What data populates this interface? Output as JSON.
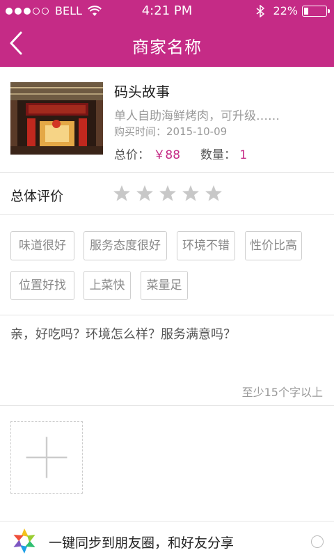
{
  "status_bar": {
    "carrier": "BELL",
    "time": "4:21 PM",
    "battery": "22%",
    "battery_level": 0.22
  },
  "nav": {
    "title": "商家名称",
    "back_icon": "chevron-left-icon"
  },
  "product": {
    "name": "码头故事",
    "description": "单人自助海鲜烤肉，可升级……",
    "purchase_date": "购买时间：2015-10-09",
    "price_label": "总价：",
    "price_value": "￥88",
    "qty_label": "数量：",
    "qty_value": "1"
  },
  "rating": {
    "label": "总体评价",
    "stars_total": 5,
    "stars_selected": 0
  },
  "tags": [
    "味道很好",
    "服务态度很好",
    "环境不错",
    "性价比高",
    "位置好找",
    "上菜快",
    "菜量足"
  ],
  "comment": {
    "placeholder": "亲，好吃吗？环境怎么样？服务满意吗？",
    "hint": "至少15个字以上"
  },
  "photos": {
    "add_icon": "plus-icon"
  },
  "share": {
    "text": "一键同步到朋友圈，和好友分享",
    "icon": "moments-icon"
  },
  "colors": {
    "accent": "#c52b86",
    "muted": "#999999"
  }
}
